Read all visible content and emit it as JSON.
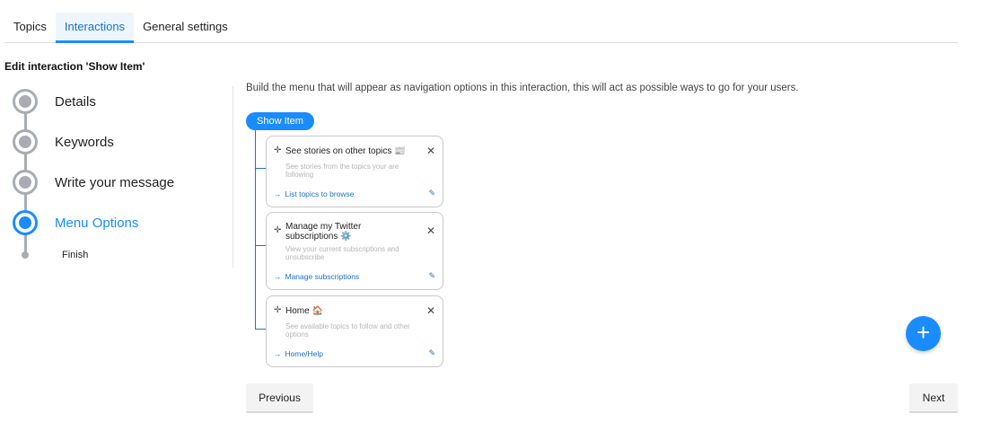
{
  "tabs": [
    {
      "label": "Topics",
      "active": false
    },
    {
      "label": "Interactions",
      "active": true
    },
    {
      "label": "General settings",
      "active": false
    }
  ],
  "edit_title": "Edit interaction 'Show Item'",
  "steps": [
    {
      "label": "Details",
      "active": false
    },
    {
      "label": "Keywords",
      "active": false
    },
    {
      "label": "Write your message",
      "active": false
    },
    {
      "label": "Menu Options",
      "active": true
    },
    {
      "label": "Finish",
      "active": false
    }
  ],
  "intro_text": "Build the menu that will appear as navigation options in this interaction, this will act as possible ways to go for your users.",
  "root_label": "Show Item",
  "menu_items": [
    {
      "title": "See stories on other topics 📰",
      "description": "See stories from the topics your are following",
      "link": "List topics to browse"
    },
    {
      "title": "Manage my Twitter subscriptions ⚙️",
      "description": "View your current subscriptions and unsubscribe",
      "link": "Manage subscriptions"
    },
    {
      "title": "Home 🏠",
      "description": "See available topics to follow and other options",
      "link": "Home/Help"
    }
  ],
  "icons": {
    "move": "move-icon",
    "close": "close-icon",
    "arrow": "arrow-right-icon",
    "edit": "pencil-icon",
    "add": "plus-icon"
  },
  "buttons": {
    "previous": "Previous",
    "next": "Next",
    "add": "+"
  },
  "colors": {
    "accent": "#1a8cff",
    "link": "#1a73c9",
    "step_inactive": "#a7adb3"
  }
}
